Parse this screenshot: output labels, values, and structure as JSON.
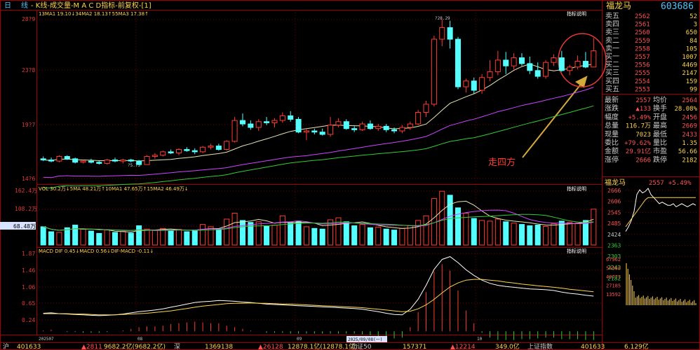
{
  "header": {
    "period": "日",
    "line_label": "线",
    "title": "- K线-成交量-M A C D指标-前复权-[1]",
    "stock_name": "福龙马",
    "stock_code": "603686"
  },
  "kline": {
    "ma_label": "13MA1 19.10↓34MA2 18.13↑55MA3 17.38↑",
    "y_ticks": [
      "28?9",
      "23?8",
      "19?7",
      "14?6"
    ],
    "hint": "指标说明",
    "high_label": "?28.29",
    "low_label": "?5.73",
    "annotation": "走四方"
  },
  "volume": {
    "label": "VOL 30.2万↓5MA 48.21万↑10MA1 47.65万↑15MA2 46.49万↓",
    "y_ticks": [
      "162.4万",
      "108.2万",
      "68.48万"
    ],
    "hint": "指标说明"
  },
  "macd": {
    "label": "MACD DIF 0.45↓MACD 0.56↓DIF-MACD -0.11↓",
    "y_ticks": [
      "1.87",
      "1.46",
      "1.06",
      "0.65",
      "0.24"
    ],
    "hint": "指标说明"
  },
  "x_axis": {
    "labels": [
      "202507",
      "08",
      "2025/09/08(一)",
      "09",
      "10"
    ]
  },
  "orderbook": {
    "sell": [
      {
        "label": "卖五",
        "price": "2562",
        "vol": "52"
      },
      {
        "label": "卖四",
        "price": "2561",
        "vol": "3"
      },
      {
        "label": "卖三",
        "price": "2560",
        "vol": "650"
      },
      {
        "label": "卖二",
        "price": "2559",
        "vol": "84"
      },
      {
        "label": "卖一",
        "price": "2558",
        "vol": "105"
      }
    ],
    "buy": [
      {
        "label": "买一",
        "price": "2557",
        "vol": "1007"
      },
      {
        "label": "买二",
        "price": "2556",
        "vol": "4469"
      },
      {
        "label": "买三",
        "price": "2555",
        "vol": "2147"
      },
      {
        "label": "买四",
        "price": "2554",
        "vol": "159"
      },
      {
        "label": "买五",
        "price": "2553",
        "vol": "99"
      }
    ]
  },
  "quote": {
    "rows": [
      {
        "l1": "最新",
        "v1": "2557",
        "l2": "均价",
        "v2": "2564"
      },
      {
        "l1": "涨跌",
        "v1": "▲133",
        "l2": "换手",
        "v2": "28.08%"
      },
      {
        "l1": "幅度",
        "v1": "+5.49%",
        "l2": "开盘",
        "v2": "2456"
      },
      {
        "l1": "总量",
        "v1": "116.7万",
        "l2": "最高",
        "v2": "2669"
      },
      {
        "l1": "现量",
        "v1": "7023",
        "l2": "最低",
        "v2": "2433"
      },
      {
        "l1": "委比",
        "v1": "+79.62%",
        "l2": "量比",
        "v2": "1.35"
      },
      {
        "l1": "金额",
        "v1": "29.91亿",
        "l2": "市盈",
        "v2": "56.66"
      },
      {
        "l1": "涨停",
        "v1": "2666",
        "l2": "跌停",
        "v2": "2182"
      }
    ]
  },
  "mini_chart": {
    "title": "福龙马",
    "price": "2557",
    "change": "+5.49%",
    "price_ticks": [
      "2666",
      "2606",
      "2545",
      "2485",
      "2424",
      "2363",
      "2303",
      "2242",
      "2182"
    ],
    "vol_ticks": [
      "67962",
      "54369",
      "40777",
      "27185",
      "13592"
    ]
  },
  "status_bar": {
    "items": [
      "沪",
      "401633",
      "▲2811",
      "9682.2亿(9682.2亿)",
      "深",
      "1369138",
      "▲26128",
      "12878.1亿(12878.1亿)",
      "北证50",
      "157371",
      "▲12214",
      "349.0亿",
      "上证指数",
      "401633",
      "6.129亿"
    ]
  },
  "chart_data": {
    "type": "candlestick",
    "title": "K线-成交量-MACD指标-前复权",
    "ylim": [
      14.6,
      28.29
    ],
    "high": 28.29,
    "low": 15.73,
    "candles": [
      [
        16.3,
        16.5,
        16.1,
        16.2
      ],
      [
        16.2,
        16.4,
        16.0,
        16.1
      ],
      [
        16.1,
        16.6,
        16.0,
        16.5
      ],
      [
        16.5,
        16.6,
        16.2,
        16.3
      ],
      [
        16.3,
        16.4,
        15.9,
        16.0
      ],
      [
        16.0,
        16.2,
        15.9,
        16.1
      ],
      [
        16.1,
        16.3,
        15.9,
        16.0
      ],
      [
        16.0,
        16.1,
        15.8,
        15.9
      ],
      [
        15.9,
        16.3,
        15.8,
        16.2
      ],
      [
        16.2,
        16.4,
        16.0,
        16.1
      ],
      [
        16.1,
        16.3,
        15.9,
        16.2
      ],
      [
        16.2,
        16.3,
        16.0,
        16.1
      ],
      [
        16.1,
        16.2,
        15.73,
        15.8
      ],
      [
        15.8,
        16.6,
        15.8,
        16.5
      ],
      [
        16.5,
        16.8,
        16.3,
        16.6
      ],
      [
        16.6,
        17.0,
        16.5,
        16.9
      ],
      [
        16.9,
        17.1,
        16.7,
        16.8
      ],
      [
        16.8,
        17.2,
        16.6,
        17.1
      ],
      [
        17.1,
        17.3,
        16.9,
        17.0
      ],
      [
        17.0,
        17.2,
        16.7,
        16.9
      ],
      [
        16.9,
        17.4,
        16.8,
        17.3
      ],
      [
        17.3,
        17.6,
        17.1,
        17.4
      ],
      [
        17.4,
        17.6,
        17.0,
        17.1
      ],
      [
        17.1,
        17.9,
        17.0,
        17.8
      ],
      [
        17.8,
        19.9,
        17.7,
        19.6
      ],
      [
        19.6,
        20.2,
        19.1,
        19.3
      ],
      [
        19.3,
        19.6,
        18.8,
        19.0
      ],
      [
        19.0,
        19.7,
        18.7,
        19.5
      ],
      [
        19.5,
        19.9,
        19.2,
        19.4
      ],
      [
        19.4,
        19.8,
        19.0,
        19.6
      ],
      [
        19.6,
        20.3,
        19.4,
        20.0
      ],
      [
        20.0,
        20.4,
        19.5,
        19.7
      ],
      [
        19.7,
        19.9,
        18.5,
        18.6
      ],
      [
        18.6,
        18.9,
        17.9,
        18.7
      ],
      [
        18.7,
        18.9,
        18.4,
        18.6
      ],
      [
        18.6,
        18.9,
        18.3,
        18.4
      ],
      [
        18.4,
        19.9,
        18.2,
        19.2
      ],
      [
        19.2,
        19.8,
        19.0,
        19.5
      ],
      [
        19.5,
        19.7,
        18.8,
        18.9
      ],
      [
        18.9,
        19.1,
        18.6,
        18.8
      ],
      [
        18.8,
        19.5,
        18.7,
        19.3
      ],
      [
        19.3,
        19.6,
        18.8,
        18.9
      ],
      [
        18.9,
        19.3,
        18.7,
        19.1
      ],
      [
        19.1,
        19.3,
        18.6,
        18.8
      ],
      [
        18.8,
        19.0,
        18.5,
        18.7
      ],
      [
        18.7,
        19.2,
        18.5,
        19.0
      ],
      [
        19.0,
        19.5,
        18.8,
        19.3
      ],
      [
        19.3,
        20.5,
        19.2,
        20.3
      ],
      [
        20.3,
        21.3,
        19.9,
        21.0
      ],
      [
        21.0,
        26.9,
        20.8,
        26.6
      ],
      [
        26.6,
        28.29,
        26.0,
        27.6
      ],
      [
        27.6,
        28.2,
        25.8,
        26.6
      ],
      [
        26.6,
        26.8,
        22.3,
        22.5
      ],
      [
        22.5,
        23.2,
        22.0,
        23.0
      ],
      [
        23.0,
        23.3,
        21.9,
        22.2
      ],
      [
        22.2,
        23.6,
        21.9,
        23.3
      ],
      [
        23.3,
        24.8,
        23.0,
        23.8
      ],
      [
        23.8,
        25.6,
        23.5,
        24.8
      ],
      [
        24.8,
        25.5,
        23.6,
        24.3
      ],
      [
        24.3,
        25.4,
        24.0,
        25.0
      ],
      [
        25.0,
        25.4,
        24.3,
        24.5
      ],
      [
        24.5,
        25.1,
        23.6,
        23.9
      ],
      [
        23.9,
        24.6,
        23.2,
        23.4
      ],
      [
        23.4,
        24.8,
        23.2,
        24.6
      ],
      [
        24.6,
        25.3,
        24.3,
        25.0
      ],
      [
        25.0,
        25.6,
        23.8,
        23.9
      ],
      [
        23.9,
        24.4,
        23.5,
        24.2
      ],
      [
        24.2,
        25.2,
        24.0,
        24.7
      ],
      [
        24.7,
        25.5,
        24.1,
        24.2
      ],
      [
        24.2,
        26.7,
        24.3,
        25.6
      ]
    ],
    "volume": [
      55,
      40,
      38,
      52,
      60,
      48,
      42,
      35,
      45,
      38,
      41,
      36,
      58,
      48,
      44,
      50,
      42,
      47,
      40,
      45,
      62,
      55,
      46,
      78,
      96,
      74,
      68,
      70,
      56,
      60,
      88,
      66,
      72,
      55,
      50,
      48,
      76,
      82,
      70,
      58,
      62,
      52,
      54,
      48,
      45,
      50,
      58,
      74,
      88,
      140,
      162,
      150,
      112,
      96,
      80,
      74,
      72,
      78,
      70,
      66,
      62,
      58,
      60,
      56,
      64,
      72,
      68,
      66,
      74,
      108
    ],
    "dif": [
      0.45,
      0.46,
      0.44,
      0.43,
      0.42,
      0.41,
      0.4,
      0.39,
      0.4,
      0.41,
      0.43,
      0.46,
      0.49,
      0.51,
      0.53,
      0.56,
      0.6,
      0.64,
      0.68,
      0.72,
      0.74,
      0.75,
      0.77,
      0.76,
      0.75,
      0.73,
      0.72,
      0.7,
      0.68,
      0.67,
      0.66,
      0.65,
      0.64,
      0.63,
      0.62,
      0.61,
      0.6,
      0.59,
      0.58,
      0.57,
      0.55,
      0.52,
      0.49,
      0.45,
      0.42,
      0.41,
      0.55,
      0.8,
      1.15,
      1.55,
      1.8,
      1.87,
      1.72,
      1.54,
      1.4,
      1.28,
      1.2,
      1.15,
      1.12,
      1.1,
      1.08,
      1.06,
      1.05,
      1.04,
      1.02,
      0.98,
      0.95,
      0.93,
      0.9,
      0.88,
      0.89,
      0.92,
      0.94,
      0.95
    ],
    "dea": [
      0.44,
      0.44,
      0.44,
      0.44,
      0.43,
      0.43,
      0.42,
      0.41,
      0.41,
      0.41,
      0.42,
      0.43,
      0.44,
      0.45,
      0.47,
      0.49,
      0.51,
      0.54,
      0.57,
      0.6,
      0.63,
      0.65,
      0.67,
      0.69,
      0.7,
      0.7,
      0.71,
      0.7,
      0.7,
      0.69,
      0.68,
      0.68,
      0.67,
      0.66,
      0.65,
      0.64,
      0.63,
      0.62,
      0.61,
      0.6,
      0.59,
      0.57,
      0.55,
      0.53,
      0.51,
      0.49,
      0.5,
      0.56,
      0.66,
      0.8,
      0.96,
      1.11,
      1.21,
      1.28,
      1.3,
      1.3,
      1.28,
      1.26,
      1.23,
      1.21,
      1.18,
      1.16,
      1.14,
      1.12,
      1.1,
      1.08,
      1.05,
      1.03,
      1.01,
      0.99,
      0.97,
      0.96,
      0.96,
      0.95
    ]
  }
}
